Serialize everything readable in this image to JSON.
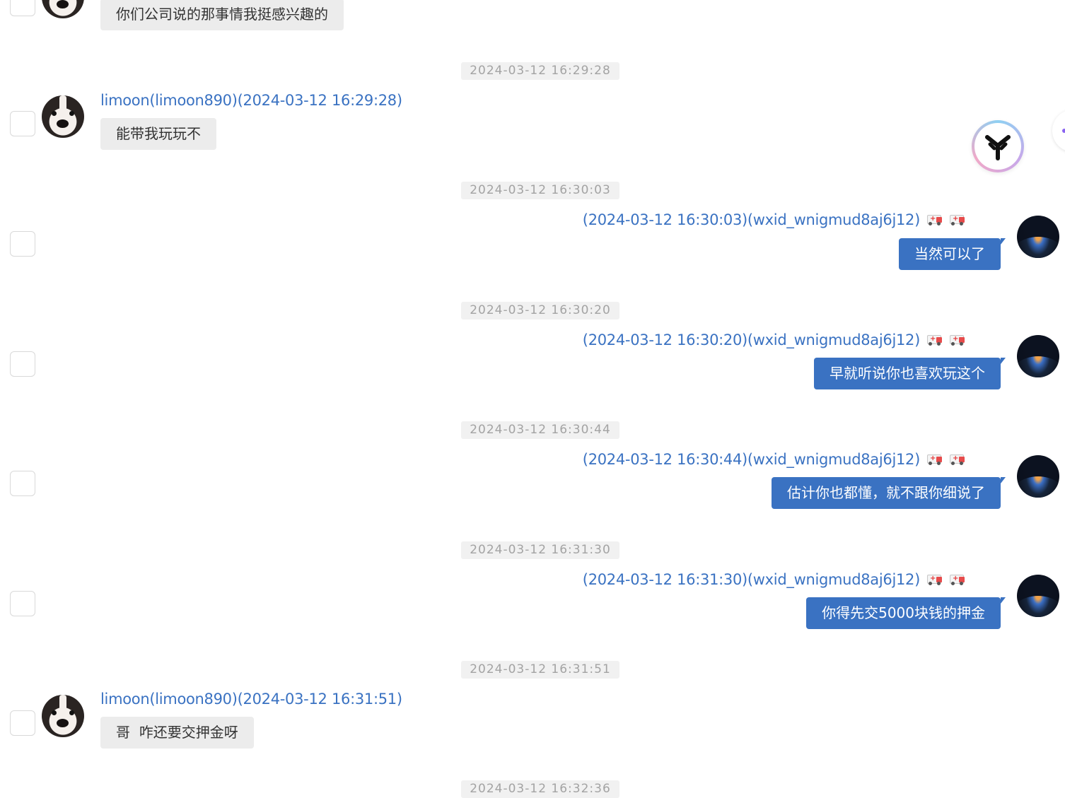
{
  "contact": {
    "name": "limoon(limoon890)"
  },
  "self": {
    "id": "(wxid_wnigmud8aj6j12)"
  },
  "messages": [
    {
      "dir": "in",
      "text": "你们公司说的那事情我挺感兴趣的"
    },
    {
      "dir": "in",
      "time_badge": "2024-03-12 16:29:28",
      "sender": "limoon(limoon890)(2024-03-12 16:29:28)",
      "text": "能带我玩玩不"
    },
    {
      "dir": "out",
      "time_badge": "2024-03-12 16:30:03",
      "sender": "(2024-03-12 16:30:03)(wxid_wnigmud8aj6j12)",
      "text": "当然可以了"
    },
    {
      "dir": "out",
      "time_badge": "2024-03-12 16:30:20",
      "sender": "(2024-03-12 16:30:20)(wxid_wnigmud8aj6j12)",
      "text": "早就听说你也喜欢玩这个"
    },
    {
      "dir": "out",
      "time_badge": "2024-03-12 16:30:44",
      "sender": "(2024-03-12 16:30:44)(wxid_wnigmud8aj6j12)",
      "text": "估计你也都懂，就不跟你细说了"
    },
    {
      "dir": "out",
      "time_badge": "2024-03-12 16:31:30",
      "sender": "(2024-03-12 16:31:30)(wxid_wnigmud8aj6j12)",
      "text": "你得先交5000块钱的押金"
    },
    {
      "dir": "in",
      "time_badge": "2024-03-12 16:31:51",
      "sender": "limoon(limoon890)(2024-03-12 16:31:51)",
      "text": "哥  咋还要交押金呀"
    },
    {
      "dir": "in",
      "time_badge": "2024-03-12 16:32:36"
    }
  ],
  "icons": {
    "sender_suffix": [
      "ambulance-icon",
      "ambulance-icon"
    ],
    "floating_widget": "tree-logo-icon"
  },
  "colors": {
    "link_blue": "#3a72c2",
    "outgoing_bubble": "#3a72c2",
    "incoming_bubble": "#ececec",
    "time_badge_bg": "#f1f1f1",
    "time_badge_text": "#a3a3a3"
  }
}
